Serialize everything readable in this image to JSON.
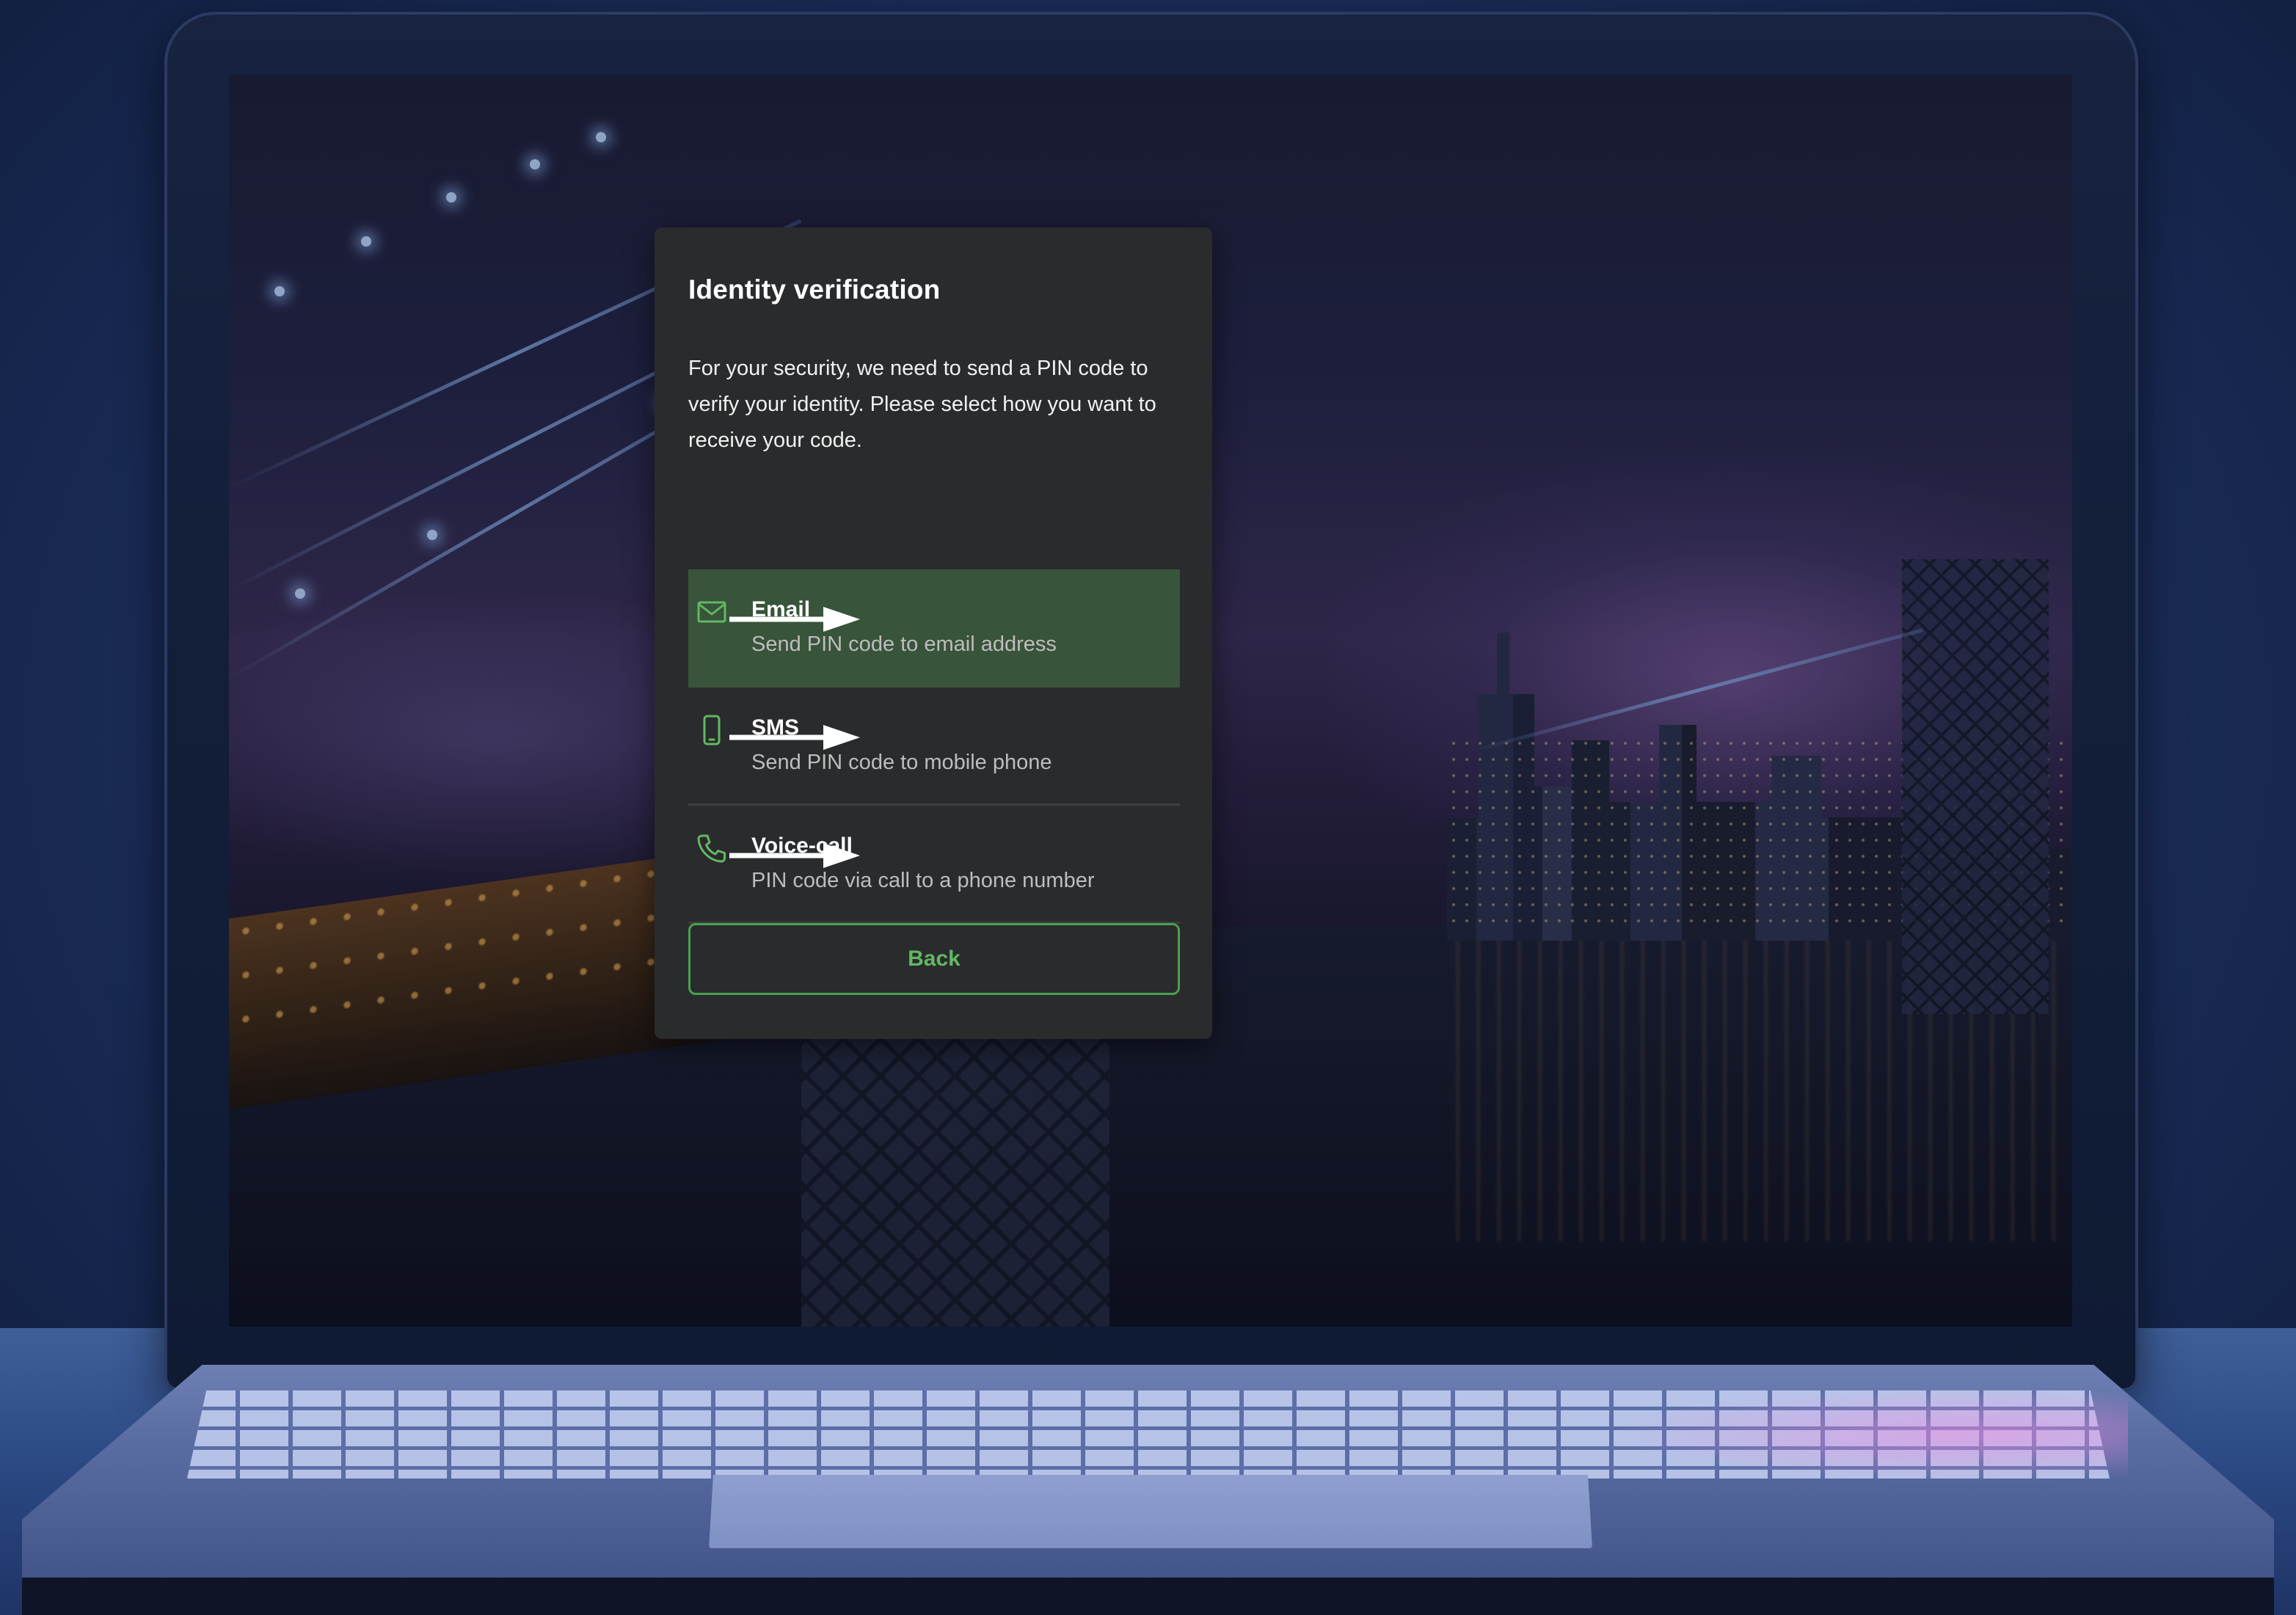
{
  "dialog": {
    "title": "Identity verification",
    "description": "For your security, we need to send a PIN code to verify your identity. Please select how you want to receive your code.",
    "options": [
      {
        "label": "Email",
        "sublabel": "Send PIN code to email address",
        "icon": "mail-icon",
        "selected": true
      },
      {
        "label": "SMS",
        "sublabel": "Send PIN code to mobile phone",
        "icon": "phone-icon",
        "selected": false
      },
      {
        "label": "Voice-call",
        "sublabel": "PIN code via call to a phone number",
        "icon": "call-icon",
        "selected": false
      }
    ],
    "back_label": "Back"
  },
  "colors": {
    "dialog_bg": "#2a2b2c",
    "selected_bg": "#38543a",
    "accent_green": "#62b863",
    "divider": "#3d3e40"
  }
}
